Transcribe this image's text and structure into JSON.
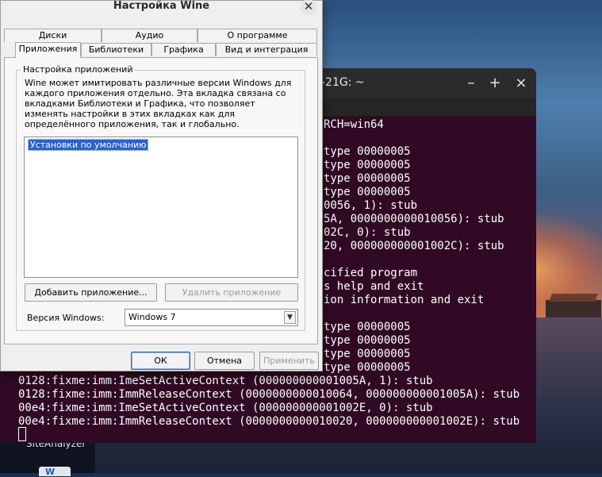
{
  "colors": {
    "terminal_bg": "#300a24",
    "selection": "#2c63c7",
    "dialog_bg": "#efefef"
  },
  "wine": {
    "title": "Настройка Wine",
    "close_icon": "close-icon",
    "tabs_row1": [
      "Диски",
      "Аудио",
      "О программе"
    ],
    "tabs_row2": [
      "Приложения",
      "Библиотеки",
      "Графика",
      "Вид и интеграция"
    ],
    "active_tab": "Приложения",
    "group_title": "Настройка приложений",
    "description": "Wine может имитировать различные версии Windows для каждого приложения отдельно. Эта вкладка связана со вкладками Библиотеки и Графика, что позволяет изменять настройки в этих вкладках как для определённого приложения, так и глобально.",
    "app_list": [
      "Установки по умолчанию"
    ],
    "add_app_label": "Добавить приложение...",
    "remove_app_label": "Удалить приложение",
    "version_label": "Версия Windows:",
    "version_value": "Windows 7",
    "ok_label": "ОК",
    "cancel_label": "Отмена",
    "apply_label": "Применить"
  },
  "terminal": {
    "title": "-21G: ~",
    "minimize": "–",
    "maximize": "+",
    "close": "×",
    "lines": [
      "RCH=win64",
      "",
      "type 00000005",
      "type 00000005",
      "type 00000005",
      "type 00000005",
      "0056, 1): stub",
      "5A, 0000000000010056): stub",
      "02C, 0): stub",
      "20, 000000000001002C): stub",
      "",
      "cified program",
      "s help and exit",
      "ion information and exit",
      "",
      "type 00000005",
      "type 00000005",
      "type 00000005",
      "type 00000005",
      "0128:fixme:imm:ImeSetActiveContext (000000000001005A, 1): stub",
      "0128:fixme:imm:ImmReleaseContext (0000000000010064, 000000000001005A): stub",
      "00e4:fixme:imm:ImeSetActiveContext (000000000001002E, 0): stub",
      "00e4:fixme:imm:ImmReleaseContext (0000000000010020, 000000000001002E): stub"
    ]
  },
  "desktop": {
    "icon_label": "SiteAnalyzer",
    "icon2_text": "W"
  }
}
